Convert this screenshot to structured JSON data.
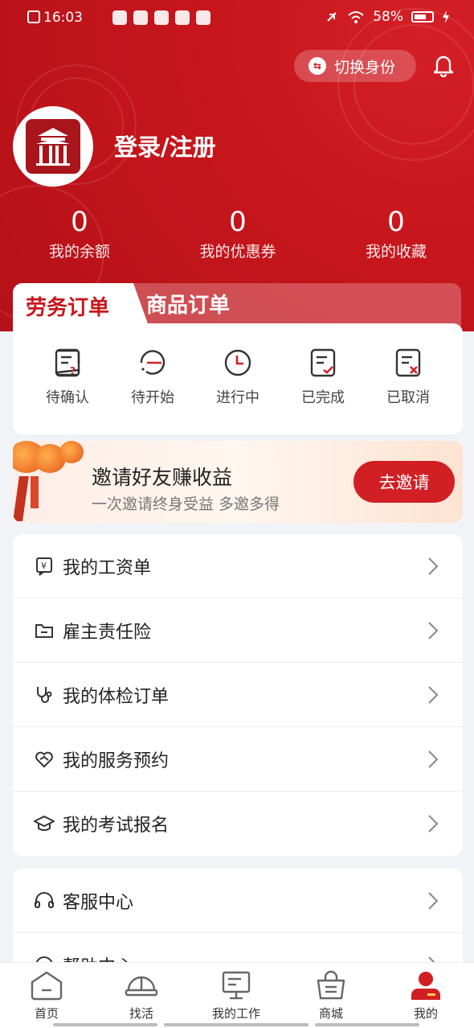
{
  "status_bar": {
    "time": "16:03",
    "battery": "58%"
  },
  "header": {
    "switch_identity": "切换身份",
    "login": "登录/注册",
    "stats": [
      {
        "value": "0",
        "label": "我的余额"
      },
      {
        "value": "0",
        "label": "我的优惠券"
      },
      {
        "value": "0",
        "label": "我的收藏"
      }
    ]
  },
  "orders": {
    "tabs": [
      "劳务订单",
      "商品订单"
    ],
    "active_tab": "劳务订单",
    "statuses": [
      {
        "label": "待确认",
        "icon": "doc-question-icon"
      },
      {
        "label": "待开始",
        "icon": "minus-circle-icon"
      },
      {
        "label": "进行中",
        "icon": "clock-icon"
      },
      {
        "label": "已完成",
        "icon": "doc-check-icon"
      },
      {
        "label": "已取消",
        "icon": "doc-x-icon"
      }
    ]
  },
  "invite": {
    "title": "邀请好友赚收益",
    "subtitle": "一次邀请终身受益 多邀多得",
    "button": "去邀请"
  },
  "menu_primary": [
    {
      "label": "我的工资单",
      "icon": "payslip-icon"
    },
    {
      "label": "雇主责任险",
      "icon": "folder-icon"
    },
    {
      "label": "我的体检订单",
      "icon": "stethoscope-icon"
    },
    {
      "label": "我的服务预约",
      "icon": "heart-hands-icon"
    },
    {
      "label": "我的考试报名",
      "icon": "graduation-cap-icon"
    }
  ],
  "menu_secondary": [
    {
      "label": "客服中心",
      "icon": "headset-icon"
    },
    {
      "label": "帮助中心",
      "icon": "help-icon"
    }
  ],
  "tabbar": [
    {
      "label": "首页",
      "icon": "home-icon"
    },
    {
      "label": "找活",
      "icon": "hardhat-icon"
    },
    {
      "label": "我的工作",
      "icon": "monitor-icon"
    },
    {
      "label": "商城",
      "icon": "basket-icon"
    },
    {
      "label": "我的",
      "icon": "user-icon",
      "active": true
    }
  ],
  "colors": {
    "brand": "#c8161d",
    "accent": "#d11f24"
  }
}
